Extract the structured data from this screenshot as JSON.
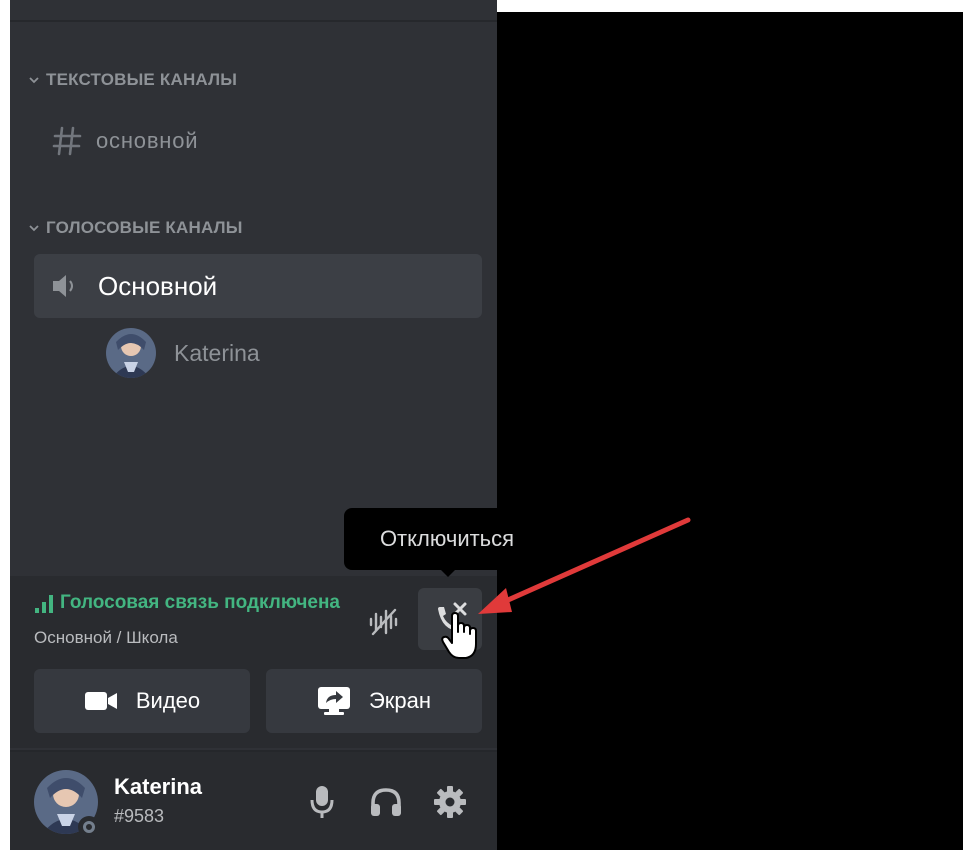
{
  "sidebar": {
    "text_category": {
      "label": "ТЕКСТОВЫЕ КАНАЛЫ",
      "icon": "chevron-down-icon"
    },
    "text_channels": [
      {
        "label": "основной",
        "icon": "hash-icon"
      }
    ],
    "voice_category": {
      "label": "ГОЛОСОВЫЕ КАНАЛЫ",
      "icon": "chevron-down-icon"
    },
    "voice_channels": [
      {
        "label": "Основной",
        "icon": "speaker-icon",
        "users": [
          {
            "name": "Katerina"
          }
        ]
      }
    ]
  },
  "voice_panel": {
    "status": "Голосовая связь подключена",
    "channel_path": "Основной / Школа",
    "noise_icon": "noise-suppression-icon",
    "disconnect_icon": "disconnect-phone-icon",
    "video_label": "Видео",
    "screen_label": "Экран"
  },
  "tooltip": {
    "text": "Отключиться"
  },
  "user": {
    "name": "Katerina",
    "tag": "#9583",
    "icons": [
      "microphone-icon",
      "headset-icon",
      "gear-icon"
    ]
  },
  "colors": {
    "sidebar_bg": "#2f3136",
    "panel_bg": "#292b2f",
    "selected_channel_bg": "#3c3f45",
    "connected_green": "#43b581",
    "muted_text": "#8e9297",
    "arrow_red": "#e03a3a"
  }
}
